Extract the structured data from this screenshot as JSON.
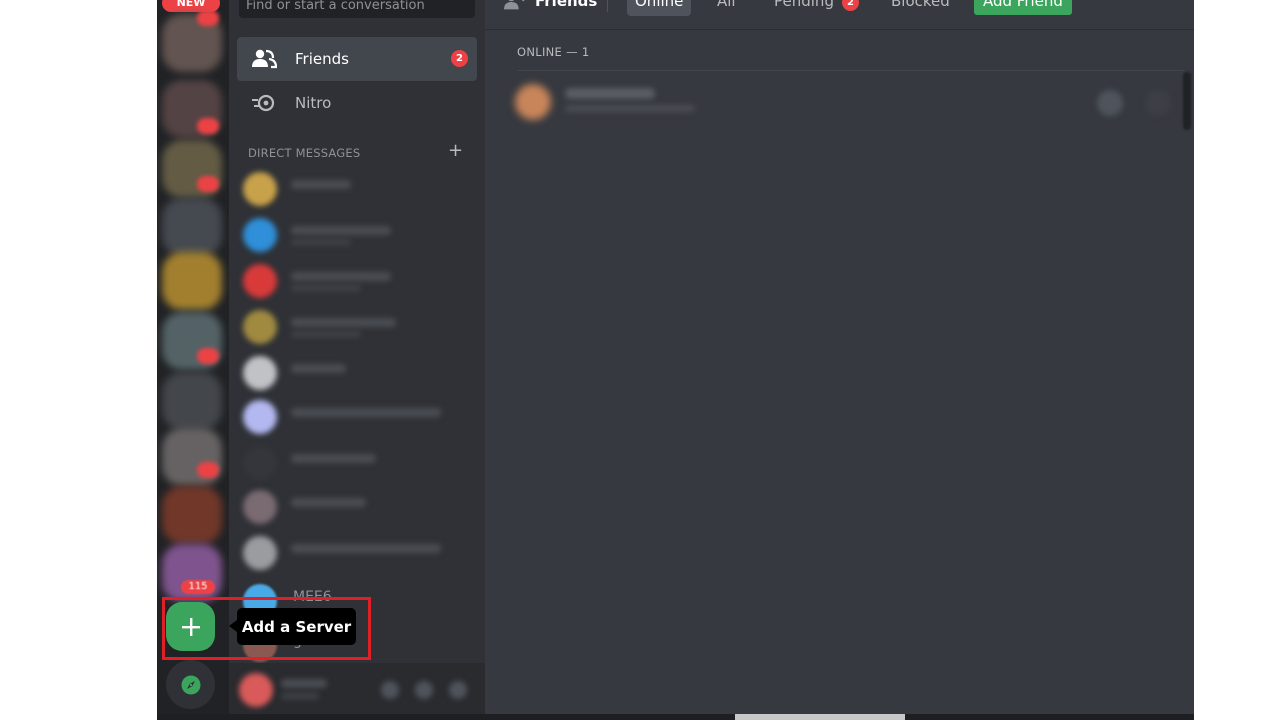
{
  "rail": {
    "new_badge": "NEW",
    "count_badge": "115",
    "add_server_icon": "plus-icon",
    "explore_icon": "compass-icon"
  },
  "sidebar": {
    "search_placeholder": "Find or start a conversation",
    "nav": [
      {
        "label": "Friends",
        "icon": "friends-wave-icon",
        "badge": "2"
      },
      {
        "label": "Nitro",
        "icon": "nitro-icon"
      }
    ],
    "dm_header": "DIRECT MESSAGES",
    "dm_visible": [
      {
        "label": "MEE6"
      },
      {
        "label": "groov"
      }
    ]
  },
  "header": {
    "title": "Friends",
    "tabs": [
      {
        "label": "Online"
      },
      {
        "label": "All"
      },
      {
        "label": "Pending",
        "badge": "2"
      },
      {
        "label": "Blocked"
      }
    ],
    "add_friend_label": "Add Friend"
  },
  "main": {
    "online_header": "ONLINE — 1"
  },
  "tooltip": {
    "text": "Add a Server"
  },
  "colors": {
    "accent_green": "#3ba55d",
    "badge_red": "#ed4245",
    "highlight_red": "#e01f26",
    "bg_main": "#36393f",
    "bg_sidebar": "#2f3136",
    "bg_rail": "#202225"
  }
}
